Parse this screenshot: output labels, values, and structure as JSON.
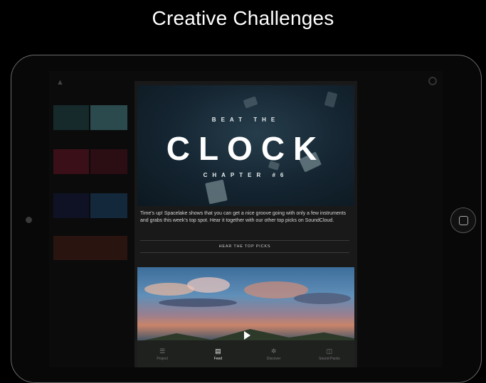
{
  "heading": "Creative Challenges",
  "banner": {
    "top_line": "BEAT THE",
    "title": "CLOCK",
    "bottom_line": "CHAPTER #6",
    "bottom_line_display": "C H A P T E R   # 6"
  },
  "description": "Time's up! Spacelake shows that you can get a nice groove going with only a few instruments and grabs this week's top spot. Hear it together with our other top picks on SoundCloud.",
  "cta_label": "HEAR THE TOP PICKS",
  "tabs": [
    {
      "label": "Project",
      "icon": "grid-icon",
      "glyph": "☰",
      "active": false
    },
    {
      "label": "Feed",
      "icon": "feed-icon",
      "glyph": "▤",
      "active": true
    },
    {
      "label": "Discover",
      "icon": "discover-icon",
      "glyph": "✲",
      "active": false
    },
    {
      "label": "Sound Packs",
      "icon": "sound-packs-icon",
      "glyph": "◫",
      "active": false
    }
  ],
  "colors": {
    "banner_bg": "#142430",
    "modal_bg": "#191919",
    "tab_active": "#e6e6e6",
    "tab_inactive": "#777777"
  }
}
